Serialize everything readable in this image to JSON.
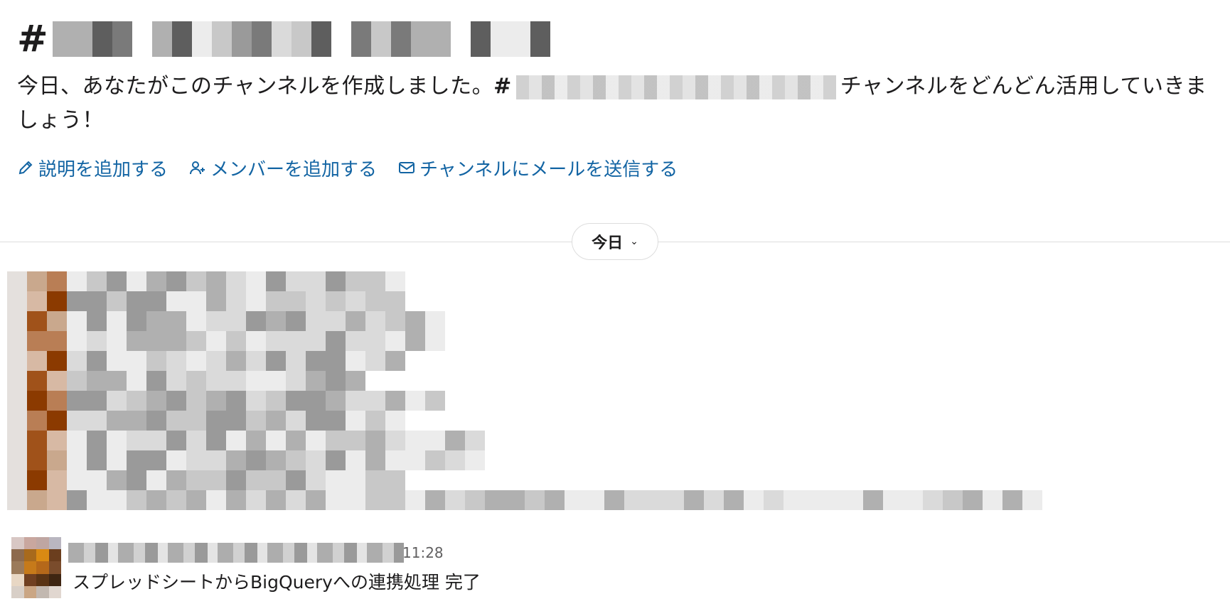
{
  "intro": {
    "hash": "#",
    "text_before": "今日、あなたがこのチャンネルを作成しました。",
    "inline_hash": "#",
    "text_after": "チャンネルをどんどん活用していきましょう！"
  },
  "actions": [
    {
      "label": "説明を追加する",
      "icon": "pencil-icon"
    },
    {
      "label": "メンバーを追加する",
      "icon": "add-user-icon"
    },
    {
      "label": "チャンネルにメールを送信する",
      "icon": "email-icon"
    }
  ],
  "divider": {
    "date_label": "今日",
    "chevron": "⌄"
  },
  "last_message": {
    "time": "11:28",
    "text": "スプレッドシートからBigQueryへの連携処理 完了"
  },
  "colors": {
    "link": "#1264a3",
    "text": "#1d1c1d",
    "muted": "#616061",
    "divider": "#dddddd"
  }
}
